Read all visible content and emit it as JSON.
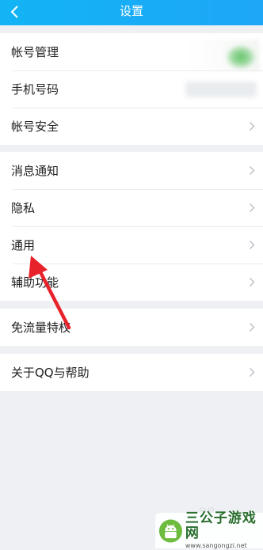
{
  "header": {
    "title": "设置",
    "back_icon": "chevron-left-icon",
    "color": "#1aacf6"
  },
  "sections": [
    {
      "items": [
        {
          "label": "帐号管理"
        },
        {
          "label": "手机号码"
        },
        {
          "label": "帐号安全"
        }
      ]
    },
    {
      "items": [
        {
          "label": "消息通知"
        },
        {
          "label": "隐私"
        },
        {
          "label": "通用"
        },
        {
          "label": "辅助功能"
        }
      ]
    },
    {
      "items": [
        {
          "label": "免流量特权"
        }
      ]
    },
    {
      "items": [
        {
          "label": "关于QQ与帮助"
        }
      ]
    }
  ],
  "annotation": {
    "arrow_color": "#e8222b",
    "points_to": "通用"
  },
  "watermark": {
    "name": "三公子游戏网",
    "url": "www.sangongzi.net"
  }
}
